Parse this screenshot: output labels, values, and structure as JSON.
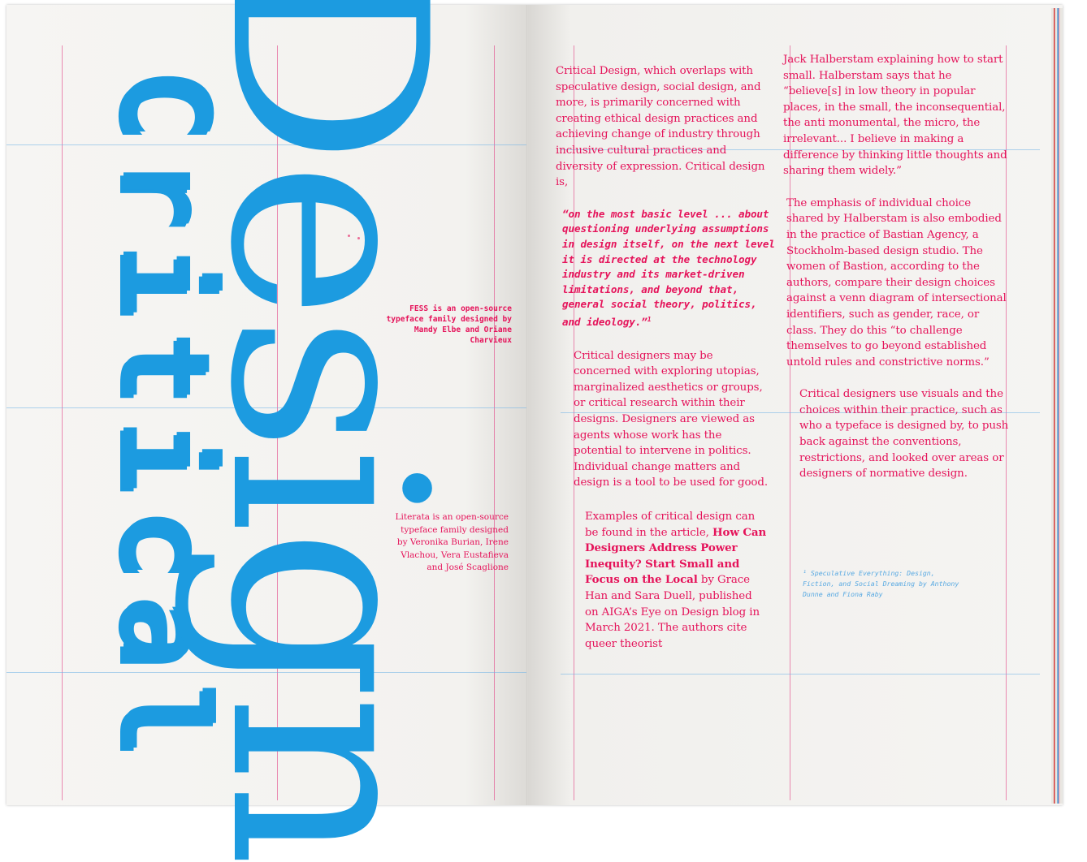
{
  "left_page": {
    "title_blackletter": "Critical",
    "title_design": "Design",
    "credit_fess": "FESS is an open-source typeface family designed by Mandy Elbe and Oriane Charvieux",
    "credit_literata": "Literata is an open-source typeface family designed by Veronika Burian, Irene Vlachou, Vera Eustafieva and José Scaglione"
  },
  "right_page": {
    "col1": {
      "para1": "Critical Design, which overlaps with speculative design, social design, and more, is primarily concerned with creating ethical design practices and achieving change of industry through inclusive cultural practices and diversity of expression. Critical design is,",
      "quote": "“on the most basic level ... about questioning underlying assumptions in design itself, on the next level it is directed at the technology industry and its market-driven limitations, and beyond that, general social theory, politics, and ideology.”",
      "quote_mark": "1",
      "para2": "Critical designers may be concerned with exploring utopias, marginalized aesthetics or groups, or critical research within their designs. Designers are viewed as agents whose work has the potential to intervene in politics. Individual change matters and design is a tool to be used for good.",
      "para3_before": "Examples of critical design can be found in the article,",
      "para3_title": "How Can Designers Address Power Inequity? Start Small and Focus on the Local",
      "para3_after": "by Grace Han and Sara Duell, published on AIGA’s Eye on Design blog in March 2021. The authors cite queer theorist"
    },
    "col2": {
      "para1": "Jack Halberstam explaining how to start small. Halberstam says that he “believe[s] in low theory in popular places, in the small, the inconsequential, the anti monumental, the micro, the irrelevant... I believe in making a difference by thinking little thoughts and sharing them widely.”",
      "para2": "The emphasis of individual choice shared by Halberstam is also embodied in the practice of Bastian Agency, a Stockholm-based design studio. The women of Bastion, according to the authors, compare their design choices against a venn diagram of intersectional identifiers, such as gender, race, or class. They do this “to challenge themselves to go beyond established untold rules and constrictive norms.”",
      "para3": "Critical designers use visuals and the choices within their practice, such as who a typeface is designed by, to push back against the conventions, restrictions, and looked over areas or designers of normative design."
    },
    "footnote": "¹ Speculative Everything: Design, Fiction, and Social Dreaming by Anthony Dunne and Fiona Raby"
  },
  "colors": {
    "blue": "#1c9be0",
    "pink": "#e5135a",
    "footnote_blue": "#58a9e2"
  }
}
